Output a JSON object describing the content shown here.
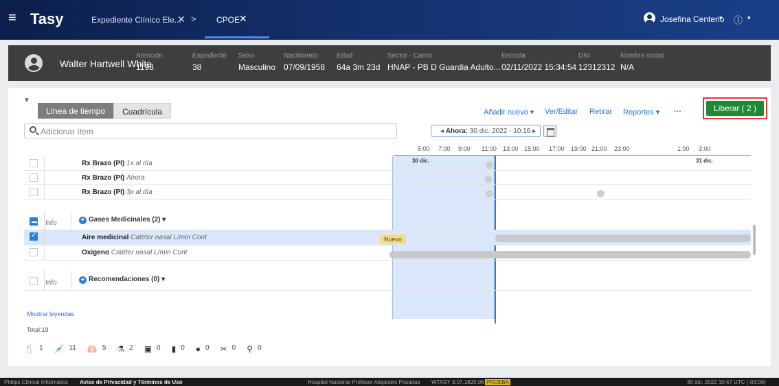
{
  "topbar": {
    "brand": "Tasy",
    "tabs": [
      {
        "label": "Expediente Clínico Ele...",
        "close": "✕"
      },
      {
        "label": "CPOE",
        "close": "✕"
      }
    ],
    "separator": ">",
    "user": "Josefina Centeno",
    "caret": "▾",
    "info_icon": "ⓘ"
  },
  "patient": {
    "name": "Walter Hartwell White",
    "fields": [
      {
        "label": "Atención",
        "value": "1198"
      },
      {
        "label": "Expediente",
        "value": "38"
      },
      {
        "label": "Sexo",
        "value": "Masculino"
      },
      {
        "label": "Nacimiento",
        "value": "07/09/1958"
      },
      {
        "label": "Edad",
        "value": "64a 3m 23d"
      },
      {
        "label": "Sector - Cama",
        "value": "HNAP - PB D Guardia Adulto..."
      },
      {
        "label": "Entrada",
        "value": "02/11/2022 15:34:54"
      },
      {
        "label": "DNI",
        "value": "12312312"
      },
      {
        "label": "Nombre social",
        "value": "N/A"
      }
    ]
  },
  "toolbar": {
    "filter_icon": "▼",
    "tab_timeline": "Línea de tiempo",
    "tab_grid": "Cuadrícula",
    "add_new": "Añadir nuevo ▾",
    "view_edit": "Ver/Editar",
    "remove": "Retirar",
    "reports": "Reportes ▾",
    "more": "···",
    "release": "Liberar ( 2 )"
  },
  "search": {
    "placeholder": "Adicionar ítem"
  },
  "timeline": {
    "now_prefix": "◂ ",
    "now_label": "Ahora:",
    "now_value": " 30 dic. 2022 - 10:16 ▸",
    "hours": [
      "5:00",
      "7:00",
      "9:00",
      "11:00",
      "13:00",
      "15:00",
      "17:00",
      "19:00",
      "21:00",
      "23:00",
      "1:00",
      "3:00"
    ],
    "date_start": "30 dic.",
    "date_next": "31 dic."
  },
  "items": [
    {
      "name": "Rx Brazo (PI)",
      "detail": "1x al día"
    },
    {
      "name": "Rx Brazo (PI)",
      "detail": "Ahora"
    },
    {
      "name": "Rx Brazo (PI)",
      "detail": "3x al día"
    }
  ],
  "groups": {
    "gases": {
      "info": "Info",
      "label": "Gases Medicinales (2) ▾"
    },
    "recomendaciones": {
      "info": "Info",
      "label": "Recomendaciones (0) ▾"
    }
  },
  "gas_items": [
    {
      "name": "Aire medicinal",
      "detail": "Catéter nasal  L/min  Cont",
      "badge": "Nuevo"
    },
    {
      "name": "Oxigeno",
      "detail": "Catéter nasal  L/min  Cont"
    }
  ],
  "legend_link": "Mostrar leyendas",
  "total_label": "Total:",
  "total_value": "19",
  "counts": [
    {
      "icon": "fork-knife-icon",
      "glyph": "🍴",
      "value": "1"
    },
    {
      "icon": "syringe-icon",
      "glyph": "💉",
      "value": "11"
    },
    {
      "icon": "lungs-icon",
      "glyph": "🫁",
      "value": "5"
    },
    {
      "icon": "lab-icon",
      "glyph": "⚗",
      "value": "2"
    },
    {
      "icon": "monitor-icon",
      "glyph": "▣",
      "value": "0"
    },
    {
      "icon": "blood-bag-icon",
      "glyph": "▮",
      "value": "0"
    },
    {
      "icon": "dialysis-icon",
      "glyph": "●",
      "value": "0"
    },
    {
      "icon": "scissors-icon",
      "glyph": "✂",
      "value": "0"
    },
    {
      "icon": "flask-icon",
      "glyph": "⚲",
      "value": "0"
    }
  ],
  "footer": {
    "company": "Philips Clinical Informatics",
    "privacy": "Aviso de Privacidad y Términos de Uso",
    "hospital": "Hospital Nacional Profesor Alejandro Posadas",
    "version": "WTASY 3.07.1820.06",
    "env": "PRUEBA",
    "datetime": "30 dic. 2022   10:47   UTC (-03:00)"
  },
  "colors": {
    "accent": "#2a7fde",
    "release": "#1e8b32",
    "highlight": "#e03a3a"
  }
}
